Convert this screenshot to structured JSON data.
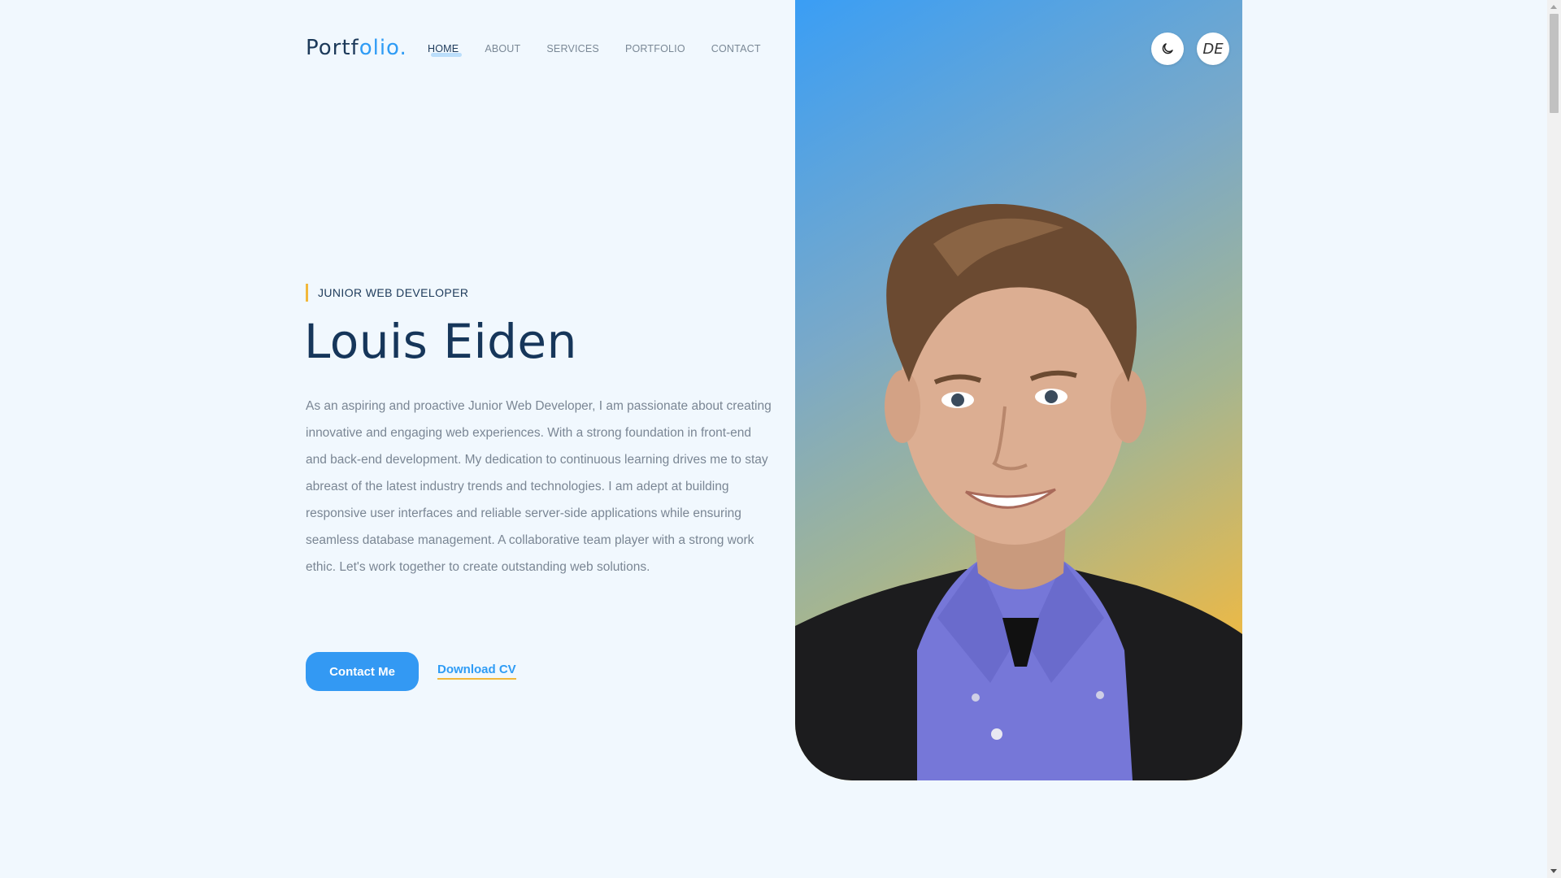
{
  "header": {
    "logo_main": "Portf",
    "logo_accent": "olio.",
    "nav": [
      {
        "label": "HOME",
        "active": true
      },
      {
        "label": "ABOUT"
      },
      {
        "label": "SERVICES"
      },
      {
        "label": "PORTFOLIO"
      },
      {
        "label": "CONTACT"
      }
    ],
    "theme_toggle_icon": "moon-icon",
    "language_button": "DE"
  },
  "hero": {
    "role": "JUNIOR WEB DEVELOPER",
    "name": "Louis Eiden",
    "bio": "As an aspiring and proactive Junior Web Developer, I am passionate about creating innovative and engaging web experiences. With a strong foundation in front-end and back-end development. My dedication to continuous learning drives me to stay abreast of the latest industry trends and technologies. I am adept at building responsive user interfaces and reliable server-side applications while ensuring seamless database management. A collaborative team player with a strong work ethic. Let's work together to create outstanding web solutions.",
    "primary_button": "Contact Me",
    "secondary_link": "Download CV"
  },
  "colors": {
    "accent_blue": "#2f9cf5",
    "accent_yellow": "#f2b83b",
    "heading": "#16365a",
    "background": "#f1f8fe"
  }
}
